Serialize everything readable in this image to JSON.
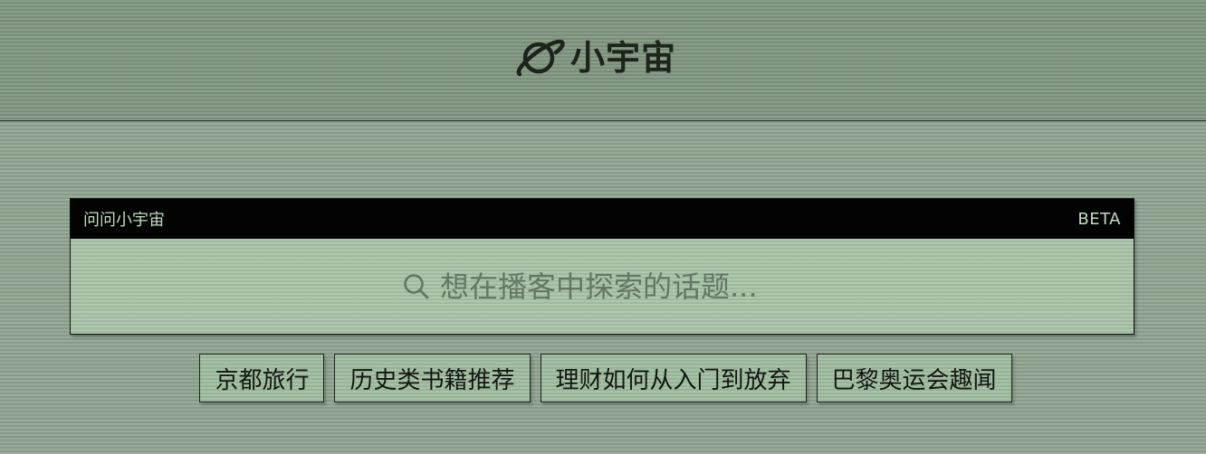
{
  "brand": {
    "name": "小宇宙",
    "icon": "planet-icon"
  },
  "ask_panel": {
    "title": "问问小宇宙",
    "badge": "BETA",
    "search": {
      "icon": "search-icon",
      "placeholder": "想在播客中探索的话题...",
      "value": ""
    }
  },
  "suggestions": [
    {
      "label": "京都旅行"
    },
    {
      "label": "历史类书籍推荐"
    },
    {
      "label": "理财如何从入门到放弃"
    },
    {
      "label": "巴黎奥运会趣闻"
    }
  ],
  "colors": {
    "background": "#8ea38e",
    "header": "#7f957f",
    "panel": "#a5c1a5",
    "panel_bar": "#030303",
    "panel_bar_text": "#c2dcc2",
    "text": "#1e241e"
  }
}
